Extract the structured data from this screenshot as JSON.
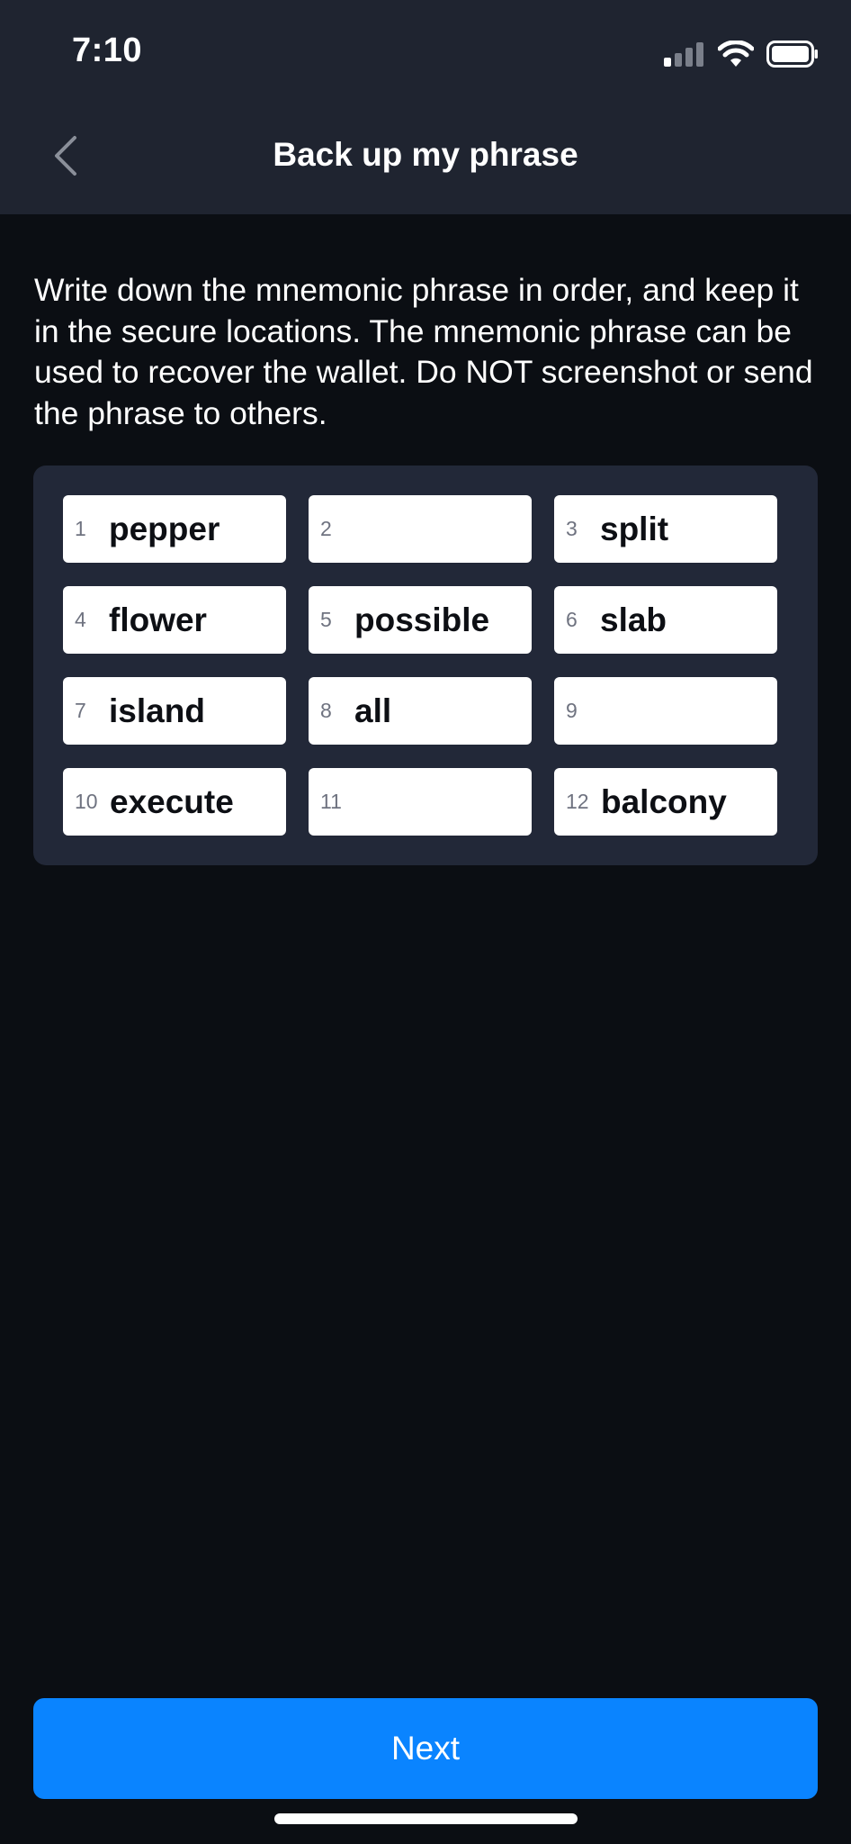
{
  "status_bar": {
    "time": "7:10",
    "icons": [
      "cellular-signal-icon",
      "wifi-icon",
      "battery-icon"
    ]
  },
  "nav": {
    "back_icon": "chevron-left-icon",
    "title": "Back up my phrase"
  },
  "instructions": "Write down the mnemonic phrase in order, and keep it in the secure locations. The mnemonic phrase can be used to recover the wallet. Do NOT screenshot or send the phrase to others.",
  "words": [
    {
      "index": "1",
      "word": "pepper"
    },
    {
      "index": "2",
      "word": ""
    },
    {
      "index": "3",
      "word": "split"
    },
    {
      "index": "4",
      "word": "flower"
    },
    {
      "index": "5",
      "word": "possible"
    },
    {
      "index": "6",
      "word": "slab"
    },
    {
      "index": "7",
      "word": "island"
    },
    {
      "index": "8",
      "word": "all"
    },
    {
      "index": "9",
      "word": ""
    },
    {
      "index": "10",
      "word": "execute"
    },
    {
      "index": "11",
      "word": ""
    },
    {
      "index": "12",
      "word": "balcony"
    }
  ],
  "next_button": {
    "label": "Next"
  },
  "colors": {
    "header_bg": "#1f2430",
    "page_bg": "#0b0e13",
    "panel_bg": "#222838",
    "accent": "#0a84ff"
  }
}
